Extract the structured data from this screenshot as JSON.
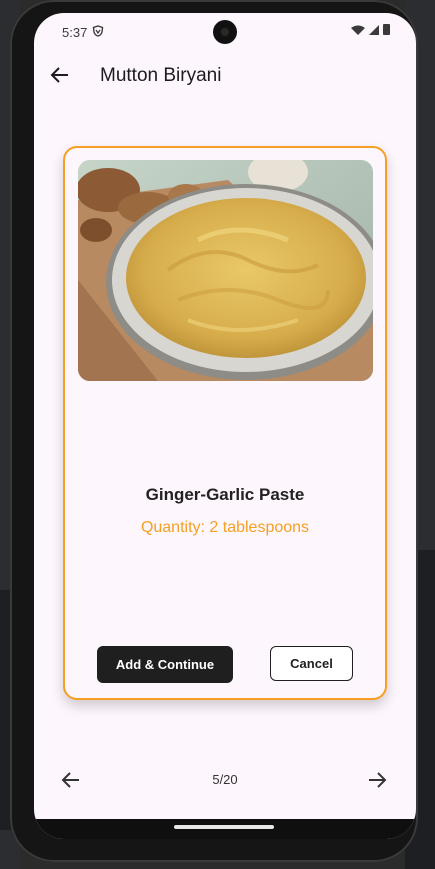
{
  "status_bar": {
    "time": "5:37",
    "icons": [
      "shield-icon",
      "wifi-icon",
      "signal-icon",
      "battery-icon"
    ]
  },
  "app_bar": {
    "back_icon": "arrow-left-icon",
    "title": "Mutton Biryani"
  },
  "ingredient_card": {
    "image": "ginger-garlic-paste-bowl-photo",
    "name": "Ginger-Garlic Paste",
    "quantity": "Quantity: 2 tablespoons",
    "primary_button": "Add & Continue",
    "secondary_button": "Cancel"
  },
  "pager": {
    "prev_icon": "arrow-left-icon",
    "indicator": "5/20",
    "next_icon": "arrow-right-icon"
  },
  "colors": {
    "accent": "#f5a023",
    "background": "#fdf6fd",
    "primary_button": "#1f1f1f"
  }
}
